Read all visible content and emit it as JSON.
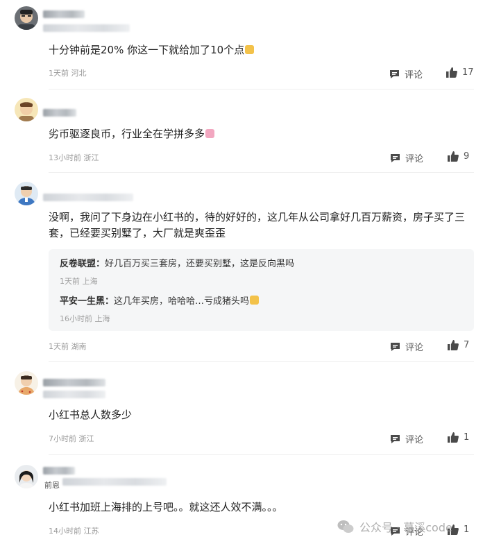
{
  "colors": {
    "text": "#222222",
    "meta": "#999999",
    "reply_bg": "#f5f6f7",
    "divider": "#eeeeee"
  },
  "actions": {
    "comment_label": "评论"
  },
  "comments": [
    {
      "content": "十分钟前是20% 你这一下就给加了10个点",
      "time": "1天前",
      "location": "河北",
      "likes": "17"
    },
    {
      "content": "劣币驱逐良币，行业全在学拼多多",
      "time": "13小时前",
      "location": "浙江",
      "likes": "9"
    },
    {
      "content": "没啊，我问了下身边在小红书的，待的好好的，这几年从公司拿好几百万薪资，房子买了三套，已经要买别墅了，大厂就是爽歪歪",
      "time": "1天前",
      "location": "湖南",
      "likes": "7",
      "replies": [
        {
          "author": "反卷联盟：",
          "text": "好几百万买三套房，还要买别墅，这是反向黑吗",
          "time": "1天前",
          "location": "上海"
        },
        {
          "author": "平安一生黑：",
          "text": "这几年买房，哈哈哈…亏成猪头吗",
          "time": "16小时前",
          "location": "上海"
        }
      ]
    },
    {
      "content": "小红书总人数多少",
      "time": "7小时前",
      "location": "浙江",
      "likes": "1"
    },
    {
      "name_partial": "前恩",
      "content": "小红书加班上海排的上号吧。。就这还人效不满。。。",
      "time": "14小时前",
      "location": "江苏",
      "likes": "1"
    }
  ],
  "watermark": {
    "label": "公众号 · 慕溪code"
  }
}
